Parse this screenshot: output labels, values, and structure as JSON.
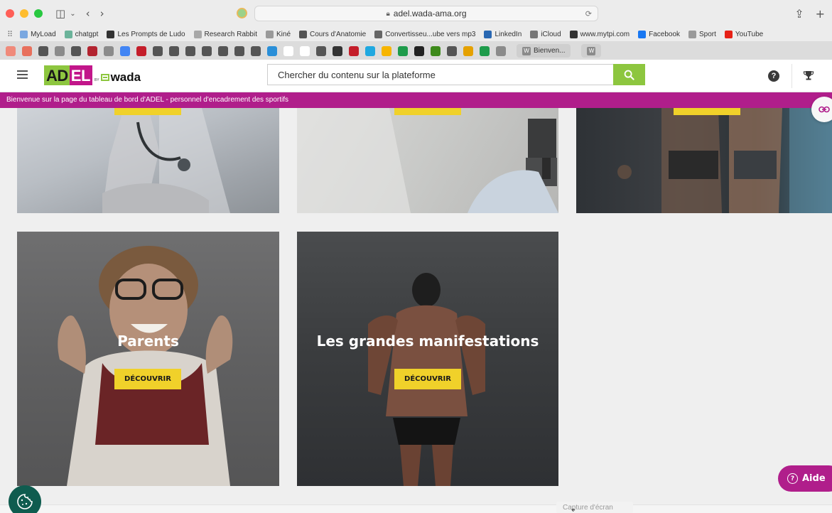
{
  "browser": {
    "url": "adel.wada-ama.org",
    "favorites": [
      {
        "label": "MyLoad",
        "color": "#7aa7e0"
      },
      {
        "label": "chatgpt",
        "color": "#6bb39a"
      },
      {
        "label": "Les Prompts de Ludo",
        "color": "#333333"
      },
      {
        "label": "Research Rabbit",
        "color": "#a8a8a8"
      },
      {
        "label": "Kiné",
        "color": "#9a9a9a",
        "folder": true
      },
      {
        "label": "Cours d'Anatomie",
        "color": "#555555"
      },
      {
        "label": "Convertisseu...ube vers mp3",
        "color": "#666666"
      },
      {
        "label": "LinkedIn",
        "color": "#2867b2"
      },
      {
        "label": "iCloud",
        "color": "#777777"
      },
      {
        "label": "www.mytpi.com",
        "color": "#333333"
      },
      {
        "label": "Facebook",
        "color": "#1877f2"
      },
      {
        "label": "Sport",
        "color": "#9a9a9a",
        "folder": true
      },
      {
        "label": "YouTube",
        "color": "#e62117"
      }
    ],
    "tab_favicons": [
      "#f08a7a",
      "#e8705c",
      "#555",
      "#8b8b8b",
      "#555",
      "#b32430",
      "#8b8b8b",
      "#4285f4",
      "#c41e2a",
      "#555",
      "#555",
      "#555",
      "#555",
      "#555",
      "#555",
      "#555",
      "#2a8fd8",
      "#fff",
      "#fff",
      "#555",
      "#333",
      "#c41e2a",
      "#1fa8e0",
      "#f7b500",
      "#1e9b4b",
      "#222",
      "#3d8a1a",
      "#555",
      "#e5a100",
      "#1e9b4b",
      "#8b8b8b"
    ],
    "active_tab": {
      "label": "Bienven...",
      "icon": "W"
    },
    "last_tab_icon": "W"
  },
  "header": {
    "logo_adel_left": "AD",
    "logo_adel_right": "EL",
    "logo_by": "BY",
    "logo_wada": "wada",
    "search_placeholder": "Chercher du contenu sur la plateforme",
    "help_icon": "?"
  },
  "banner": {
    "text": "Bienvenue sur la page du tableau de bord d'ADEL - personnel d'encadrement des sportifs"
  },
  "cards": [
    {
      "title": "Parents",
      "button": "DÉCOUVRIR"
    },
    {
      "title": "Les grandes manifestations",
      "button": "DÉCOUVRIR"
    }
  ],
  "aide": {
    "label": "Aide",
    "icon": "?"
  },
  "screenshot_tooltip": "Capture d'écran",
  "colors": {
    "brand_green": "#8dc63f",
    "brand_magenta": "#b01e8b",
    "button_yellow": "#f0d12a"
  }
}
